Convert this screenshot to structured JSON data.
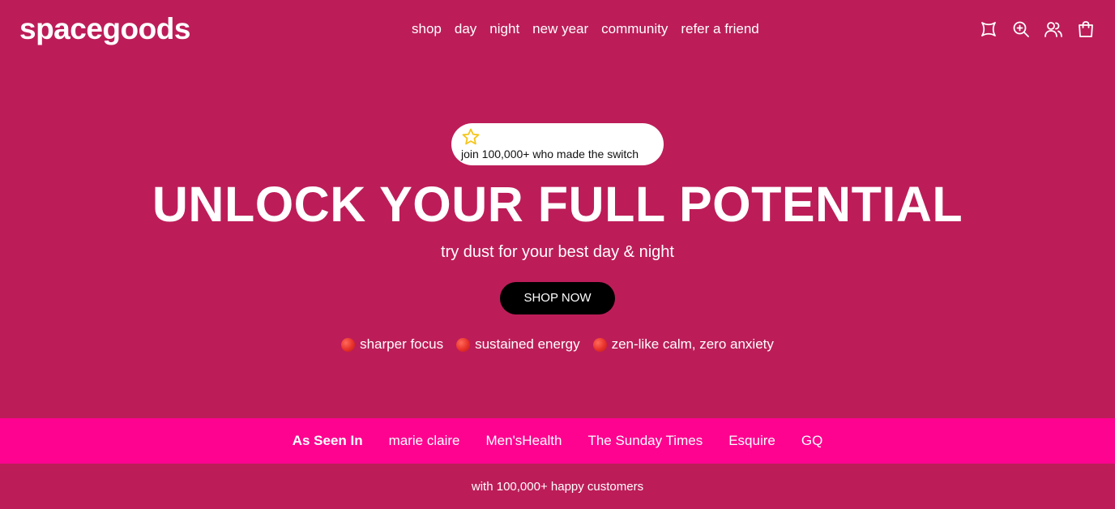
{
  "header": {
    "logo": "spacegoods",
    "nav": [
      {
        "label": "shop"
      },
      {
        "label": "day"
      },
      {
        "label": "night"
      },
      {
        "label": "new year"
      },
      {
        "label": "community"
      },
      {
        "label": "refer a friend"
      }
    ],
    "icons": [
      "rewards-icon",
      "search-icon",
      "account-icon",
      "cart-icon"
    ]
  },
  "hero": {
    "badge_text": "join 100,000+ who made the switch",
    "headline": "UNLOCK YOUR FULL POTENTIAL",
    "subhead": "try dust for your best day & night",
    "cta_label": "SHOP NOW",
    "benefits": [
      {
        "label": "sharper focus"
      },
      {
        "label": "sustained energy"
      },
      {
        "label": "zen-like calm, zero anxiety"
      }
    ]
  },
  "press": {
    "label": "As Seen In",
    "outlets": [
      "marie claire",
      "Men'sHealth",
      "The Sunday Times",
      "Esquire",
      "GQ"
    ]
  },
  "footer_note": "with 100,000+ happy customers",
  "colors": {
    "background": "#bc1d58",
    "press_bar": "#fd0390",
    "cta": "#000000",
    "star": "#f5c518"
  }
}
